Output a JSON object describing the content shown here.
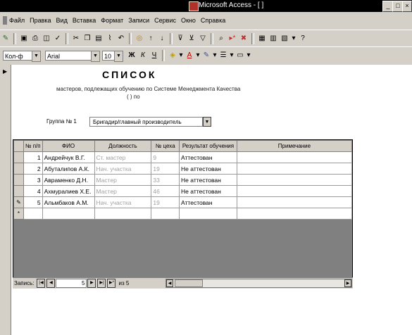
{
  "window": {
    "title": "Microsoft Access - [            ]"
  },
  "menu": [
    "Файл",
    "Правка",
    "Вид",
    "Вставка",
    "Формат",
    "Записи",
    "Сервис",
    "Окно",
    "Справка"
  ],
  "toolbar2": {
    "field_combo": "Кол-ф",
    "font_combo": "Arial",
    "size_combo": "10"
  },
  "report": {
    "title": "СПИСОК",
    "subtitle": "мастеров, подлежащих обучению по Системе Менеджмента Качества",
    "subtitle2": "(          ) по",
    "group_label": "Группа № 1",
    "group_value": "Бригадир/главный производитель"
  },
  "table": {
    "headers": [
      "№ п/п",
      "ФИО",
      "Должность",
      "№ цеха",
      "Результат обучения",
      "Примечание"
    ],
    "rows": [
      {
        "selector": "",
        "num": "1",
        "name": "Андрейчук В.Г.",
        "position": "Ст. мастер",
        "shop": "9",
        "result": "Аттестован",
        "note": ""
      },
      {
        "selector": "",
        "num": "2",
        "name": "Абуталипов А.К.",
        "position": "Нач. участка",
        "shop": "19",
        "result": "Не аттестован",
        "note": ""
      },
      {
        "selector": "",
        "num": "3",
        "name": "Авраменко Д.Н.",
        "position": "Мастер",
        "shop": "33",
        "result": "Не аттестован",
        "note": ""
      },
      {
        "selector": "",
        "num": "4",
        "name": "Ахмуралиев Х.Е.",
        "position": "Мастер",
        "shop": "46",
        "result": "Не аттестован",
        "note": ""
      },
      {
        "selector": "✎",
        "num": "5",
        "name": "Альмбаков А.М.",
        "position": "Нач. участка",
        "shop": "19",
        "result": "Аттестован",
        "note": ""
      }
    ],
    "new_row_marker": "*"
  },
  "navigator": {
    "label": "Запись:",
    "current": "5",
    "total": "из 5"
  }
}
